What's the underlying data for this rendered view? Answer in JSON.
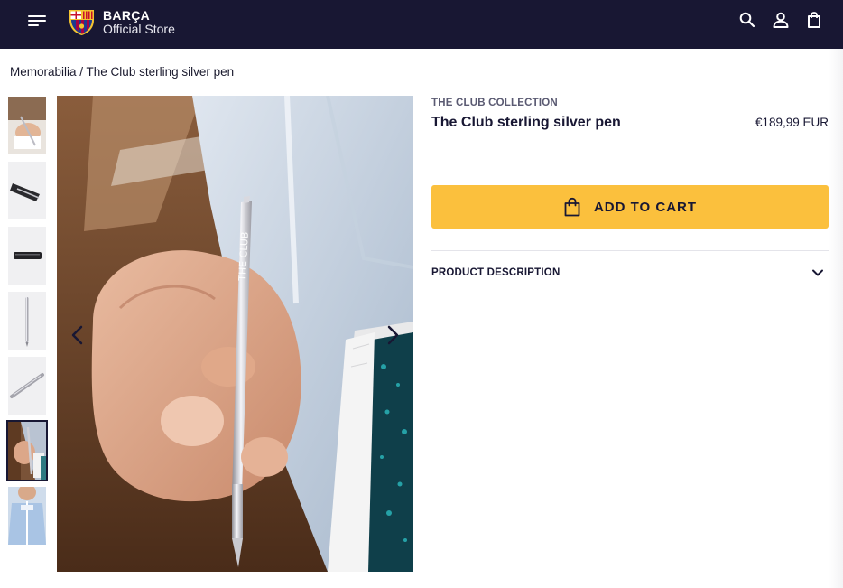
{
  "header": {
    "brand_name": "BARÇA",
    "brand_sub": "Official Store",
    "icons": [
      "menu-icon",
      "search-icon",
      "user-icon",
      "bag-icon"
    ]
  },
  "breadcrumb": {
    "parent": "Memorabilia",
    "separator": " / ",
    "current": "The Club sterling silver pen"
  },
  "gallery": {
    "thumbnails": [
      "hand-writing-with-pen",
      "pen-in-box",
      "pen-case-closed",
      "pen-vertical",
      "pen-diagonal",
      "pen-held-closeup",
      "person-with-pen"
    ],
    "active_index": 5,
    "engraving": "THE CLUB"
  },
  "product": {
    "collection": "THE CLUB COLLECTION",
    "title": "The Club sterling silver pen",
    "price": "€189,99 EUR",
    "add_to_cart": "ADD TO CART",
    "description_label": "PRODUCT DESCRIPTION"
  },
  "colors": {
    "header_bg": "#181733",
    "cart_button": "#fbc03d",
    "text_primary": "#181733"
  }
}
